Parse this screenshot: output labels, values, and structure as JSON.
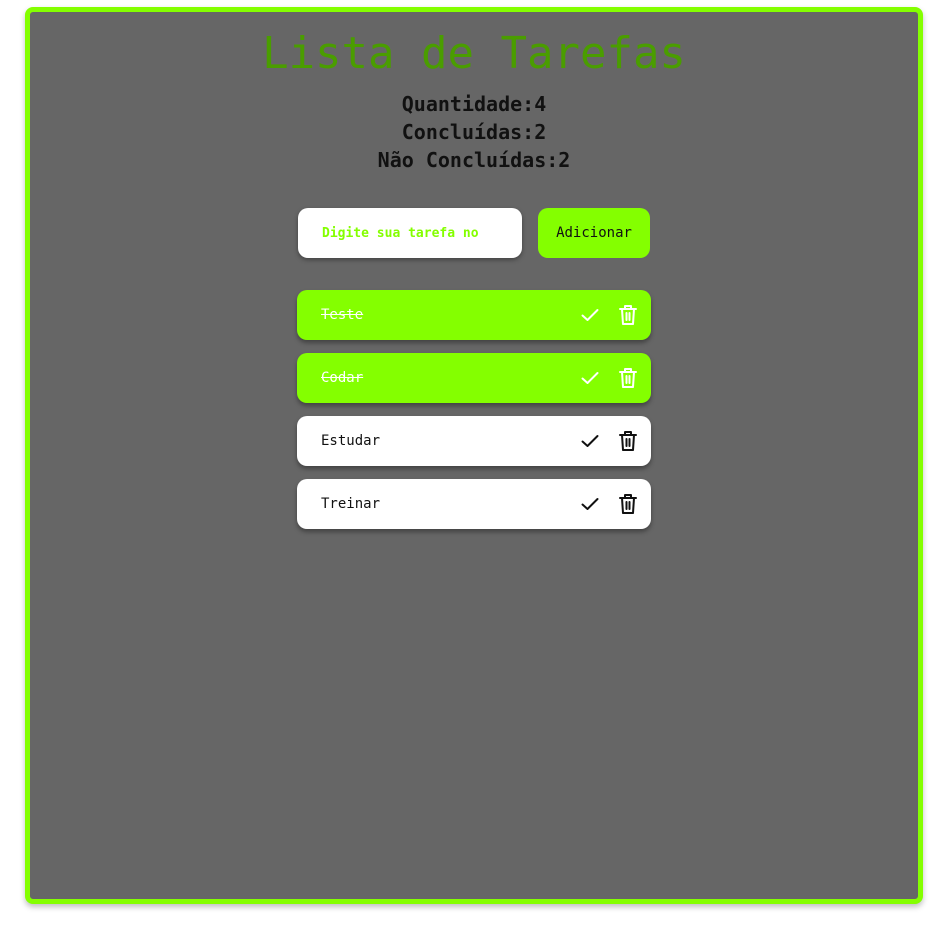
{
  "app": {
    "title": "Lista de Tarefas"
  },
  "stats": {
    "total": "Quantidade:4",
    "done": "Concluídas:2",
    "pending": "Não Concluídas:2"
  },
  "form": {
    "placeholder": "Digite sua tarefa no",
    "value": "",
    "add_label": "Adicionar"
  },
  "tasks": [
    {
      "text": "Teste",
      "done": true
    },
    {
      "text": "Codar",
      "done": true
    },
    {
      "text": "Estudar",
      "done": false
    },
    {
      "text": "Treinar",
      "done": false
    }
  ],
  "icons": {
    "check": "check-icon",
    "delete": "trash-icon"
  },
  "colors": {
    "accent": "#84ff00",
    "title": "#4a9d00",
    "background": "#666666",
    "card": "#ffffff"
  }
}
